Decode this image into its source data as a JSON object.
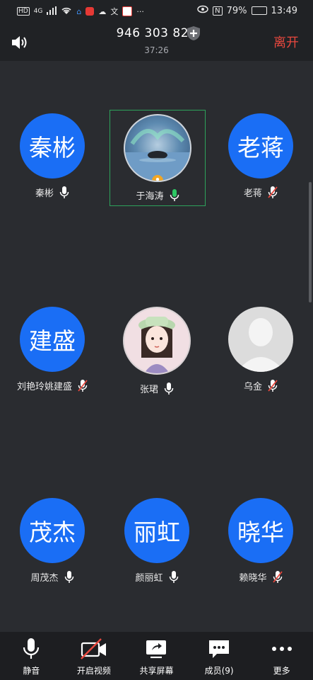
{
  "status_bar": {
    "left_items": [
      "HD",
      "4G",
      "📶",
      "wifi",
      "app",
      "app",
      "app",
      "文",
      "app",
      "···"
    ],
    "battery_percent": "79%",
    "battery_level": 0.79,
    "time": "13:49"
  },
  "header": {
    "meeting_id": "946 303 821",
    "timer": "37:26",
    "leave_label": "离开"
  },
  "participants": [
    {
      "avatar_text": "秦彬",
      "name": "秦彬",
      "mic": "on",
      "avatar": "initials"
    },
    {
      "avatar_text": "",
      "name": "于海涛",
      "mic": "active",
      "avatar": "photo-aurora",
      "host": true,
      "speaking": true
    },
    {
      "avatar_text": "老蒋",
      "name": "老蒋",
      "mic": "muted",
      "avatar": "initials"
    },
    {
      "avatar_text": "建盛",
      "name": "刘艳玲姚建盛",
      "mic": "muted",
      "avatar": "initials"
    },
    {
      "avatar_text": "",
      "name": "张珺",
      "mic": "on",
      "avatar": "photo-girl"
    },
    {
      "avatar_text": "",
      "name": "乌金",
      "mic": "muted",
      "avatar": "photo-default"
    },
    {
      "avatar_text": "茂杰",
      "name": "周茂杰",
      "mic": "on",
      "avatar": "initials"
    },
    {
      "avatar_text": "丽虹",
      "name": "颜丽虹",
      "mic": "on",
      "avatar": "initials"
    },
    {
      "avatar_text": "晓华",
      "name": "赖晓华",
      "mic": "muted",
      "avatar": "initials"
    }
  ],
  "toolbar": {
    "mute_label": "静音",
    "video_label": "开启视频",
    "share_label": "共享屏幕",
    "members_label": "成员(9)",
    "more_label": "更多"
  },
  "colors": {
    "accent_blue": "#1a6ef5",
    "leave_red": "#e8483e",
    "speaking_green": "#2ea35b",
    "host_badge": "#f3a623"
  }
}
